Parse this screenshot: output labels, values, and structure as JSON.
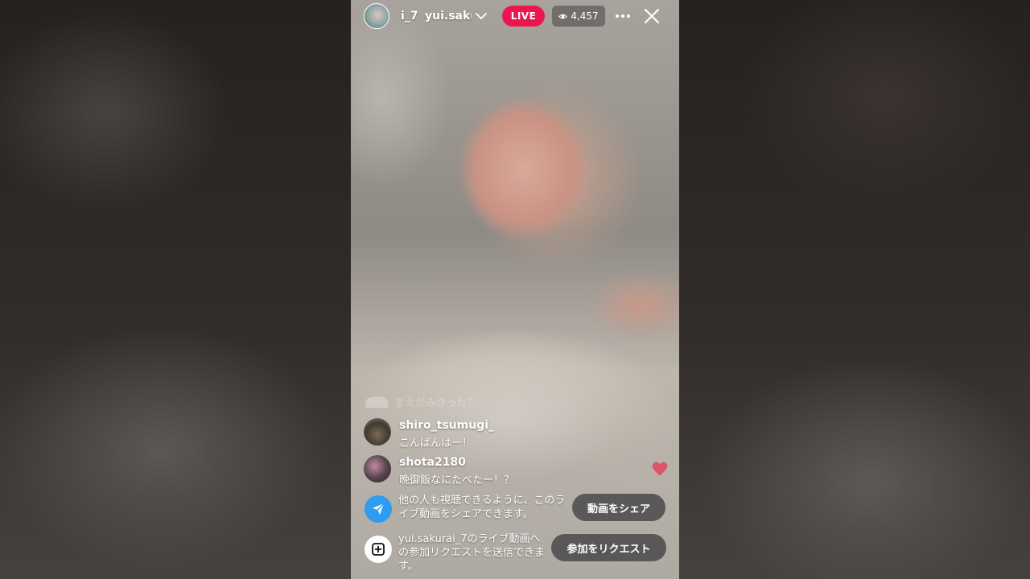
{
  "header": {
    "host_name_left": "i_7",
    "host_name_right": "yui.saku",
    "live_label": "LIVE",
    "viewer_count": "4,457"
  },
  "comments": {
    "faded_text": "まえがみきった？",
    "items": [
      {
        "user": "shiro_tsumugi_",
        "message": "こんばんはー！"
      },
      {
        "user": "shota2180",
        "message": "晩御飯なにたべたー！？"
      }
    ]
  },
  "notices": {
    "share": {
      "text": "他の人も視聴できるように、このライブ動画をシェアできます。",
      "button": "動画をシェア"
    },
    "request": {
      "text": "yui.sakurai_7のライブ動画への参加リクエストを送信できます。",
      "button": "参加をリクエスト"
    }
  },
  "colors": {
    "live_badge": "#e8184e",
    "share_icon_bg": "#2f9cf0",
    "heart": "#e0445f"
  },
  "icons": [
    "chevron-down-icon",
    "eye-icon",
    "more-icon",
    "close-icon",
    "heart-icon",
    "share-arrow-icon",
    "add-video-icon"
  ]
}
